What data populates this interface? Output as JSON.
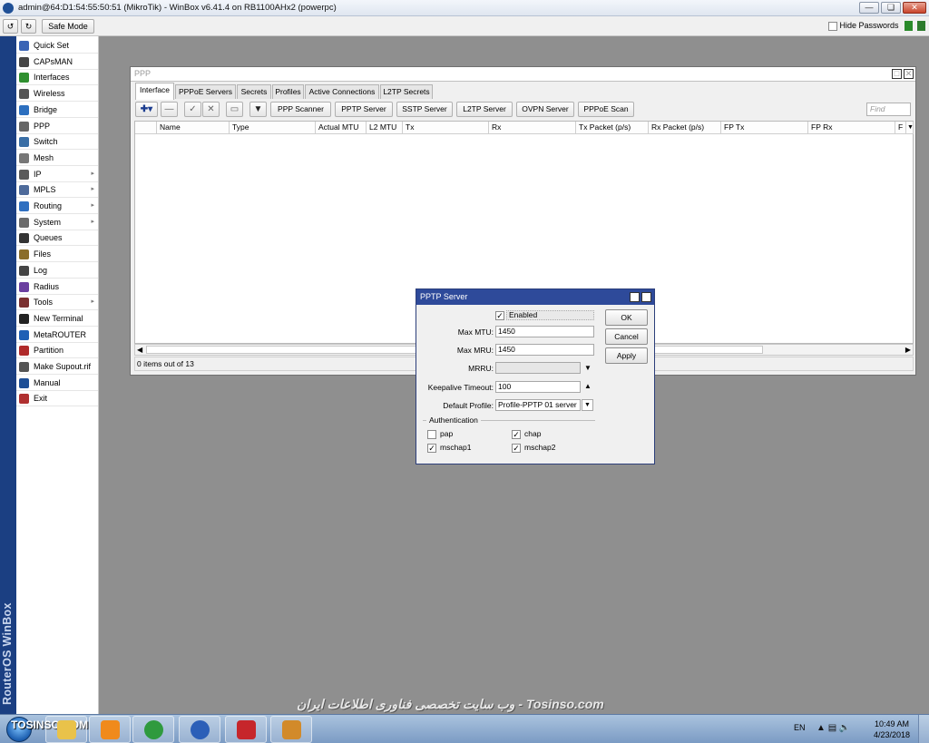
{
  "window": {
    "title": "admin@64:D1:54:55:50:51 (MikroTik) - WinBox v6.41.4 on RB1100AHx2 (powerpc)"
  },
  "toolbar": {
    "undo_icon": "undo-icon",
    "redo_icon": "redo-icon",
    "safe_mode_label": "Safe Mode",
    "hide_passwords_label": "Hide Passwords",
    "hide_passwords_checked": false
  },
  "sidebar": {
    "brand": "RouterOS WinBox",
    "items": [
      {
        "label": "Quick Set",
        "icon": "quick-set-icon",
        "submenu": false
      },
      {
        "label": "CAPsMAN",
        "icon": "capsman-icon",
        "submenu": false
      },
      {
        "label": "Interfaces",
        "icon": "interfaces-icon",
        "submenu": false
      },
      {
        "label": "Wireless",
        "icon": "wireless-icon",
        "submenu": false
      },
      {
        "label": "Bridge",
        "icon": "bridge-icon",
        "submenu": false
      },
      {
        "label": "PPP",
        "icon": "ppp-icon",
        "submenu": false
      },
      {
        "label": "Switch",
        "icon": "switch-icon",
        "submenu": false
      },
      {
        "label": "Mesh",
        "icon": "mesh-icon",
        "submenu": false
      },
      {
        "label": "IP",
        "icon": "ip-icon",
        "submenu": true
      },
      {
        "label": "MPLS",
        "icon": "mpls-icon",
        "submenu": true
      },
      {
        "label": "Routing",
        "icon": "routing-icon",
        "submenu": true
      },
      {
        "label": "System",
        "icon": "system-icon",
        "submenu": true
      },
      {
        "label": "Queues",
        "icon": "queues-icon",
        "submenu": false
      },
      {
        "label": "Files",
        "icon": "files-icon",
        "submenu": false
      },
      {
        "label": "Log",
        "icon": "log-icon",
        "submenu": false
      },
      {
        "label": "Radius",
        "icon": "radius-icon",
        "submenu": false
      },
      {
        "label": "Tools",
        "icon": "tools-icon",
        "submenu": true
      },
      {
        "label": "New Terminal",
        "icon": "terminal-icon",
        "submenu": false
      },
      {
        "label": "MetaROUTER",
        "icon": "metarouter-icon",
        "submenu": false
      },
      {
        "label": "Partition",
        "icon": "partition-icon",
        "submenu": false
      },
      {
        "label": "Make Supout.rif",
        "icon": "supout-icon",
        "submenu": false
      },
      {
        "label": "Manual",
        "icon": "manual-icon",
        "submenu": false
      },
      {
        "label": "Exit",
        "icon": "exit-icon",
        "submenu": false
      }
    ]
  },
  "ppp_window": {
    "title": "PPP",
    "tabs": [
      "Interface",
      "PPPoE Servers",
      "Secrets",
      "Profiles",
      "Active Connections",
      "L2TP Secrets"
    ],
    "active_tab": "Interface",
    "server_buttons": [
      "PPP Scanner",
      "PPTP Server",
      "SSTP Server",
      "L2TP Server",
      "OVPN Server",
      "PPPoE Scan"
    ],
    "find_placeholder": "Find",
    "columns": [
      "Name",
      "Type",
      "Actual MTU",
      "L2 MTU",
      "Tx",
      "Rx",
      "Tx Packet (p/s)",
      "Rx Packet (p/s)",
      "FP Tx",
      "FP Rx",
      "F"
    ],
    "rows": [],
    "status": "0 items out of 13"
  },
  "pptp_dialog": {
    "title": "PPTP Server",
    "enabled_label": "Enabled",
    "enabled": true,
    "max_mtu_label": "Max MTU:",
    "max_mtu": "1450",
    "max_mru_label": "Max MRU:",
    "max_mru": "1450",
    "mrru_label": "MRRU:",
    "mrru": "",
    "keepalive_label": "Keepalive Timeout:",
    "keepalive": "100",
    "default_profile_label": "Default Profile:",
    "default_profile": "Profile-PPTP 01 server",
    "auth_label": "Authentication",
    "auth": [
      {
        "label": "pap",
        "checked": false
      },
      {
        "label": "chap",
        "checked": true
      },
      {
        "label": "mschap1",
        "checked": true
      },
      {
        "label": "mschap2",
        "checked": true
      }
    ],
    "ok_label": "OK",
    "cancel_label": "Cancel",
    "apply_label": "Apply"
  },
  "watermark": "وب سایت تخصصی فناوری اطلاعات ایران - Tosinso.com",
  "taskbar": {
    "logo_text": "TOSINSO.COM",
    "apps": [
      "explorer-icon",
      "media-player-icon",
      "chrome-icon",
      "winbox-icon",
      "acrobat-icon",
      "paint-icon"
    ],
    "language": "EN",
    "time": "10:49 AM",
    "date": "4/23/2018"
  }
}
